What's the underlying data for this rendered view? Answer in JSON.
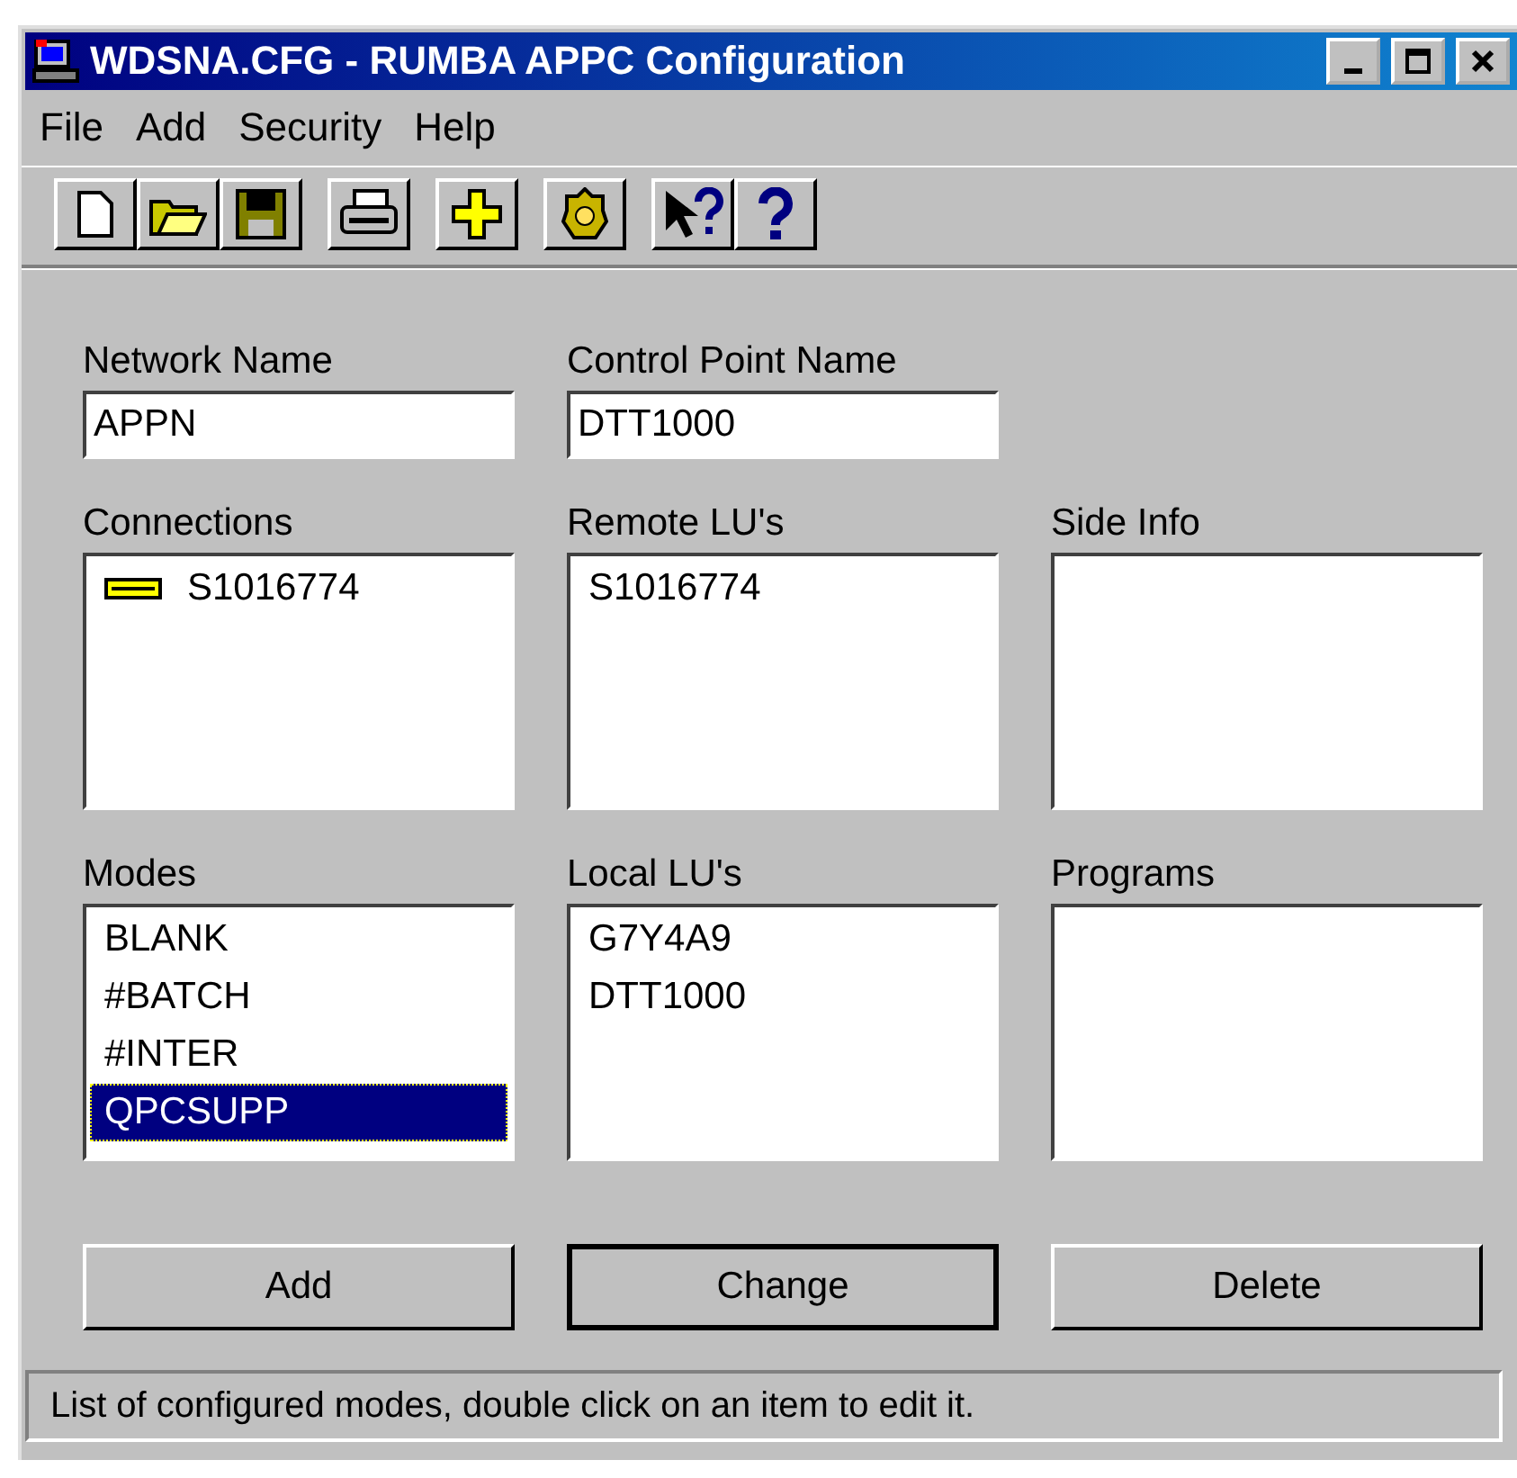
{
  "window": {
    "title": "WDSNA.CFG - RUMBA APPC Configuration"
  },
  "menu": [
    "File",
    "Add",
    "Security",
    "Help"
  ],
  "toolbar": [
    {
      "kind": "new"
    },
    {
      "kind": "open"
    },
    {
      "kind": "save"
    },
    {
      "kind": "gap"
    },
    {
      "kind": "print"
    },
    {
      "kind": "gap"
    },
    {
      "kind": "add"
    },
    {
      "kind": "gap"
    },
    {
      "kind": "badge"
    },
    {
      "kind": "gap"
    },
    {
      "kind": "context-help"
    },
    {
      "kind": "help"
    }
  ],
  "fields": [
    {
      "label": "Network Name",
      "value": "APPN"
    },
    {
      "label": "Control Point Name",
      "value": "DTT1000"
    }
  ],
  "lists": [
    {
      "label": "Connections",
      "kind": "connection",
      "items": [
        {
          "text": "S1016774",
          "selected": false
        }
      ]
    },
    {
      "label": "Remote LU's",
      "items": [
        {
          "text": "S1016774",
          "selected": false
        }
      ]
    },
    {
      "label": "Side Info"
    },
    {
      "label": "Modes",
      "items": [
        {
          "text": "BLANK",
          "selected": false
        },
        {
          "text": "#BATCH",
          "selected": false
        },
        {
          "text": "#INTER",
          "selected": false
        },
        {
          "text": "QPCSUPP",
          "selected": true
        }
      ]
    },
    {
      "label": "Local LU's",
      "items": [
        {
          "text": "G7Y4A9",
          "selected": false
        },
        {
          "text": "DTT1000",
          "selected": false
        }
      ]
    },
    {
      "label": "Programs"
    }
  ],
  "buttons": [
    {
      "label": "Add",
      "default": false
    },
    {
      "label": "Change",
      "default": true
    },
    {
      "label": "Delete",
      "default": false
    }
  ],
  "status_bar": "List of configured modes, double click on an item to edit it."
}
